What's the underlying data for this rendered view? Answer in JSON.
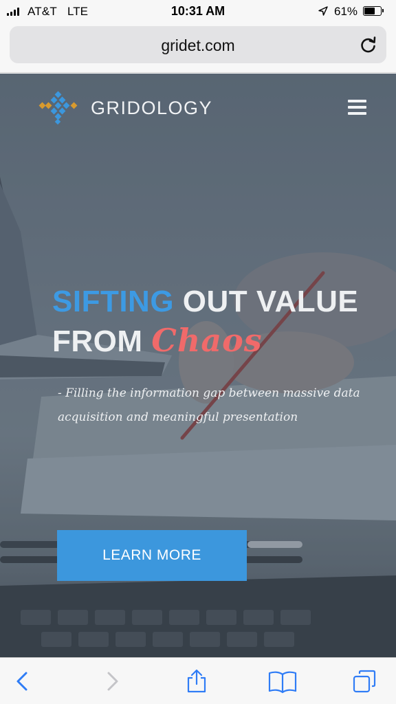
{
  "status_bar": {
    "carrier": "AT&T",
    "network": "LTE",
    "time": "10:31 AM",
    "battery_percent": "61%",
    "battery_level": 0.61
  },
  "browser": {
    "url": "gridet.com"
  },
  "site": {
    "brand": "GRIDOLOGY",
    "headline": {
      "part1": "SIFTING",
      "part2": " OUT VALUE",
      "part3": "FROM ",
      "part4": "Chaos"
    },
    "tagline_line1": "- Filling the information gap between massive data",
    "tagline_line2": "acquisition and meaningful presentation",
    "cta_label": "LEARN MORE"
  },
  "colors": {
    "accent_blue": "#3d9ae3",
    "accent_red": "#f06a6a",
    "button_blue": "#3c97dd",
    "ios_blue": "#2f7cf6"
  },
  "toolbar": {
    "icons": [
      "back-icon",
      "forward-icon",
      "share-icon",
      "bookmarks-icon",
      "tabs-icon"
    ]
  }
}
